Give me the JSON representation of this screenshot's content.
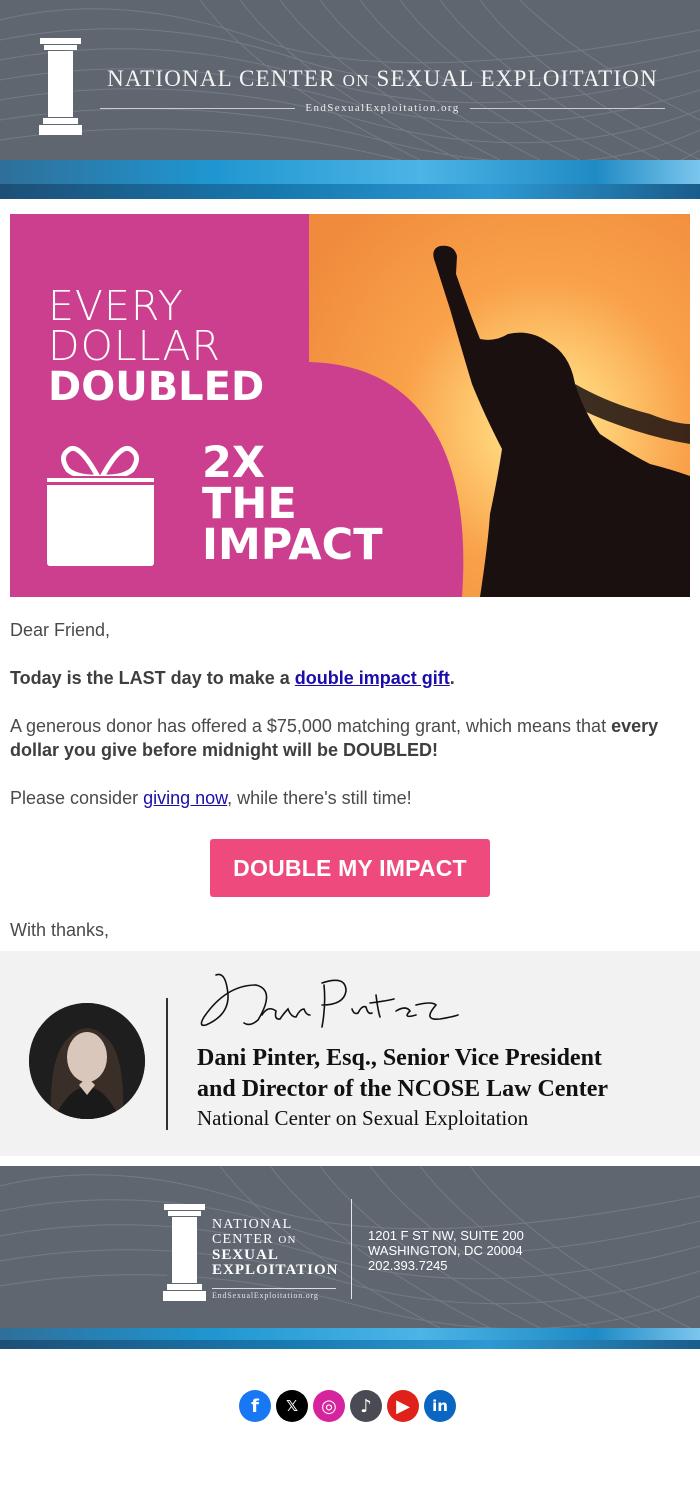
{
  "header": {
    "org_name_part1": "NATIONAL CENTER",
    "org_name_on": "ON",
    "org_name_part2": "SEXUAL EXPLOITATION",
    "website": "EndSexualExploitation.org",
    "logo_icon": "pillar-icon"
  },
  "hero": {
    "line1": "EVERY",
    "line2": "DOLLAR",
    "line3": "DOUBLED",
    "impact1": "2X",
    "impact2": "THE",
    "impact3": "IMPACT",
    "gift_icon": "gift-icon"
  },
  "body": {
    "greeting": "Dear Friend,",
    "p1_bold": "Today is the LAST day to make a ",
    "p1_link": "double impact gift",
    "p1_end": ".",
    "p2_text": "A generous donor has offered a $75,000 matching grant, which means that ",
    "p2_bold": "every dollar you give before midnight will be DOUBLED",
    "p2_end": "!",
    "p3_start": "Please consider ",
    "p3_link": "giving now",
    "p3_end": ", while there's still time!",
    "cta_label": "DOUBLE MY IMPACT",
    "closing": "With thanks,"
  },
  "signature": {
    "script": "Dani Pintez",
    "name_line1": "Dani Pinter, Esq., Senior Vice President",
    "name_line2": "and Director of the NCOSE Law Center",
    "organization": "National Center on Sexual Exploitation"
  },
  "footer": {
    "org_line1": "NATIONAL",
    "org_line2a": "CENTER",
    "org_line2b": "ON",
    "org_line3": "SEXUAL",
    "org_line4": "EXPLOITATION",
    "website": "EndSexualExploitation.org",
    "address1": "1201 F ST NW, SUITE 200",
    "address2": "WASHINGTON, DC 20004",
    "phone": "202.393.7245"
  },
  "social": [
    {
      "name": "facebook-icon",
      "glyph": "f",
      "color": "#1877f2"
    },
    {
      "name": "x-icon",
      "glyph": "𝕏",
      "color": "#000000"
    },
    {
      "name": "instagram-icon",
      "glyph": "◎",
      "color": "#d6249f"
    },
    {
      "name": "tiktok-icon",
      "glyph": "♪",
      "color": "#4a4a55"
    },
    {
      "name": "youtube-icon",
      "glyph": "▶",
      "color": "#e0201b"
    },
    {
      "name": "linkedin-icon",
      "glyph": "in",
      "color": "#0a66c2"
    }
  ]
}
